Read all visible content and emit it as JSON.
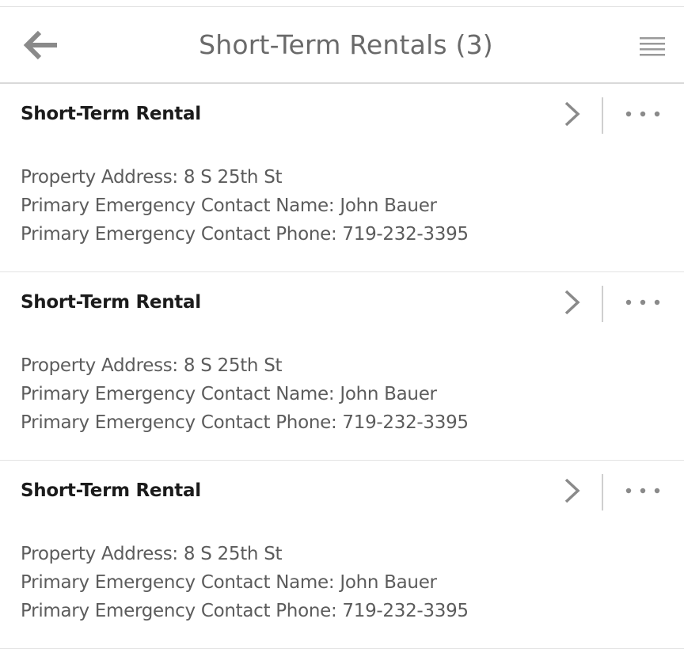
{
  "header": {
    "title": "Short-Term Rentals (3)",
    "back_icon": "arrow-left-icon",
    "menu_icon": "hamburger-menu-icon"
  },
  "records": [
    {
      "title": "Short-Term Rental",
      "lines": [
        "Property Address: 8 S 25th St",
        "Primary Emergency Contact Name: John Bauer",
        "Primary Emergency Contact Phone: 719-232-3395"
      ]
    },
    {
      "title": "Short-Term Rental",
      "lines": [
        "Property Address: 8 S 25th St",
        "Primary Emergency Contact Name: John Bauer",
        "Primary Emergency Contact Phone: 719-232-3395"
      ]
    },
    {
      "title": "Short-Term Rental",
      "lines": [
        "Property Address: 8 S 25th St",
        "Primary Emergency Contact Name: John Bauer",
        "Primary Emergency Contact Phone: 719-232-3395"
      ]
    }
  ],
  "icons": {
    "row_open": "chevron-right-icon",
    "row_more": "more-dots-icon"
  },
  "colors": {
    "title_text": "#1b1b1b",
    "header_text": "#6a6a6a",
    "detail_text": "#5c5c5c",
    "icon_gray": "#8a8a8a",
    "divider": "#d9d9d9"
  }
}
